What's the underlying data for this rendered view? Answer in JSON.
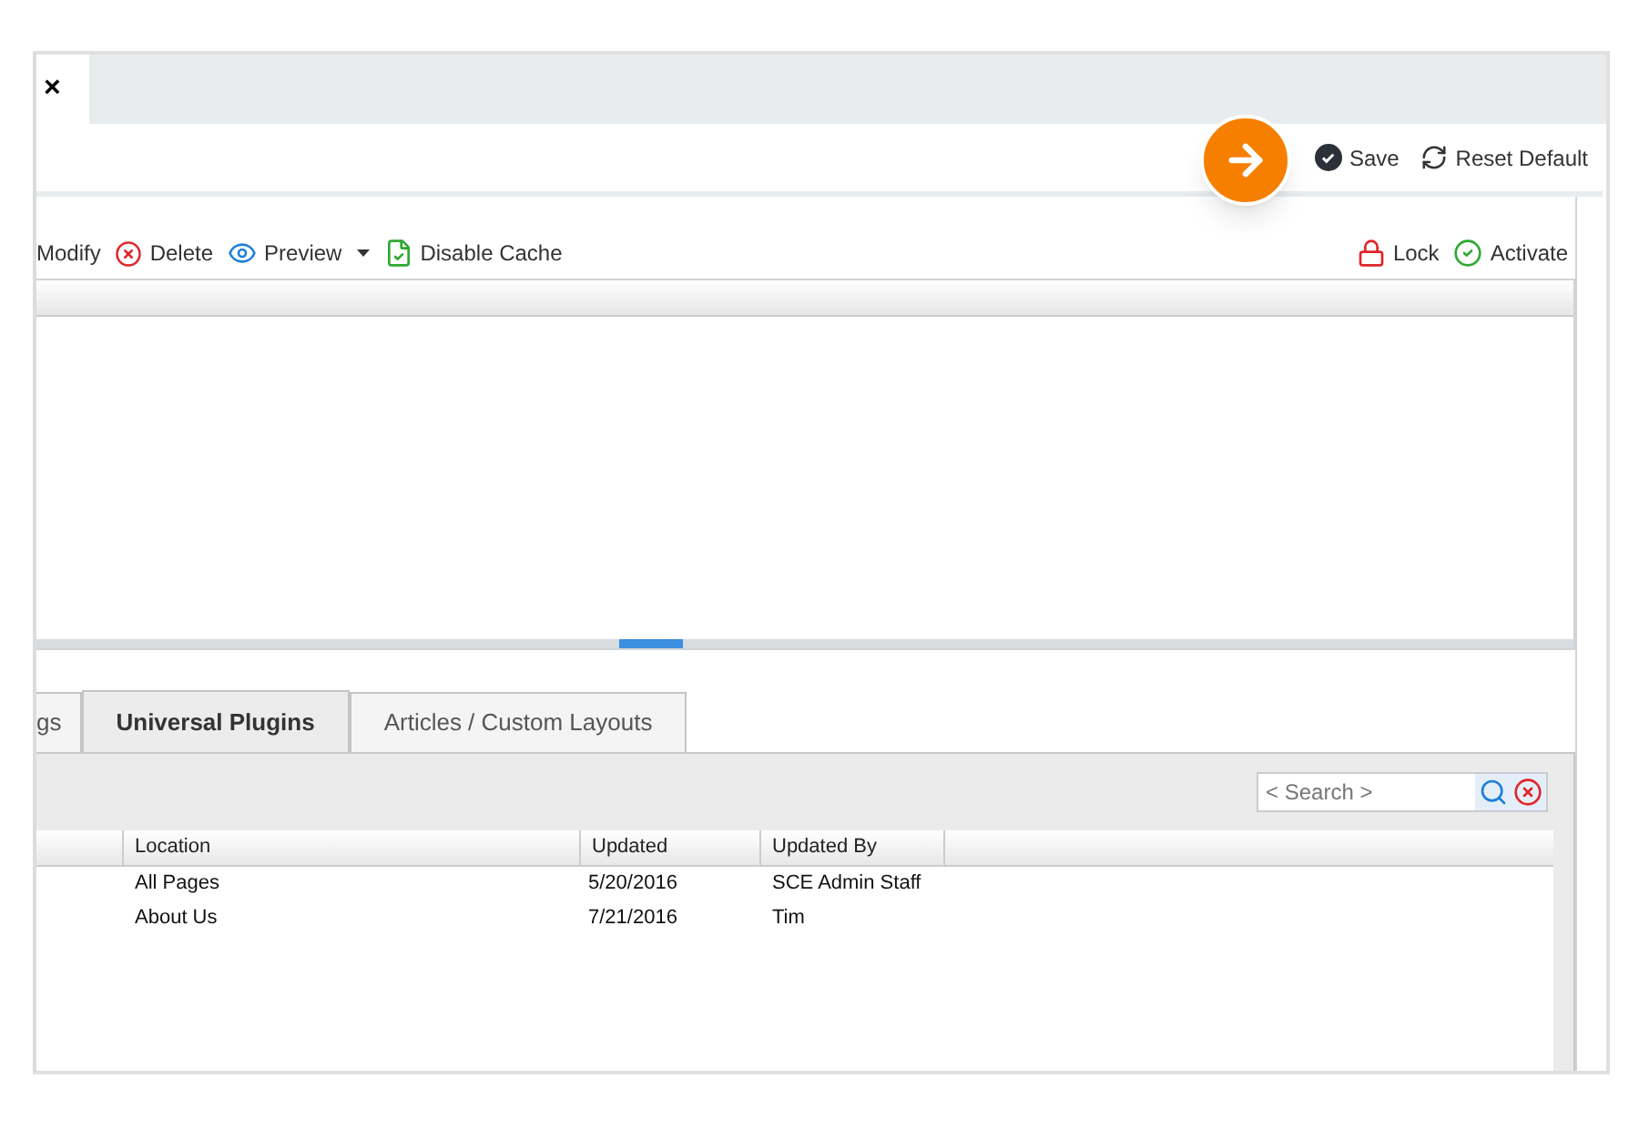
{
  "window": {
    "tabs": [
      {
        "label": "×",
        "selected": true
      }
    ]
  },
  "toolbar": {
    "actions": [
      {
        "label": "Save",
        "kind": "save"
      },
      {
        "label": "Reset Default",
        "kind": "reset"
      }
    ]
  },
  "list_toolbar": {
    "left": [
      {
        "label": "Modify",
        "kind": "plain"
      },
      {
        "label": "Delete",
        "kind": "delete"
      },
      {
        "label": "Preview",
        "kind": "preview",
        "dropdown": true
      },
      {
        "label": "Disable Cache",
        "kind": "cache"
      }
    ],
    "right": [
      {
        "label": "Lock",
        "kind": "lock"
      },
      {
        "label": "Activate",
        "kind": "activate"
      }
    ]
  },
  "tabs": [
    {
      "label": "gs",
      "selected": false
    },
    {
      "label": "Universal Plugins",
      "selected": true
    },
    {
      "label": "Articles / Custom Layouts",
      "selected": false
    }
  ],
  "search": {
    "placeholder": "< Search >"
  },
  "table": {
    "columns": [
      "Location",
      "Updated",
      "Updated By"
    ],
    "rows": [
      {
        "location": "All Pages",
        "updated": "5/20/2016",
        "updated_by": "SCE Admin Staff"
      },
      {
        "location": "About Us",
        "updated": "7/21/2016",
        "updated_by": "Tim"
      }
    ]
  }
}
